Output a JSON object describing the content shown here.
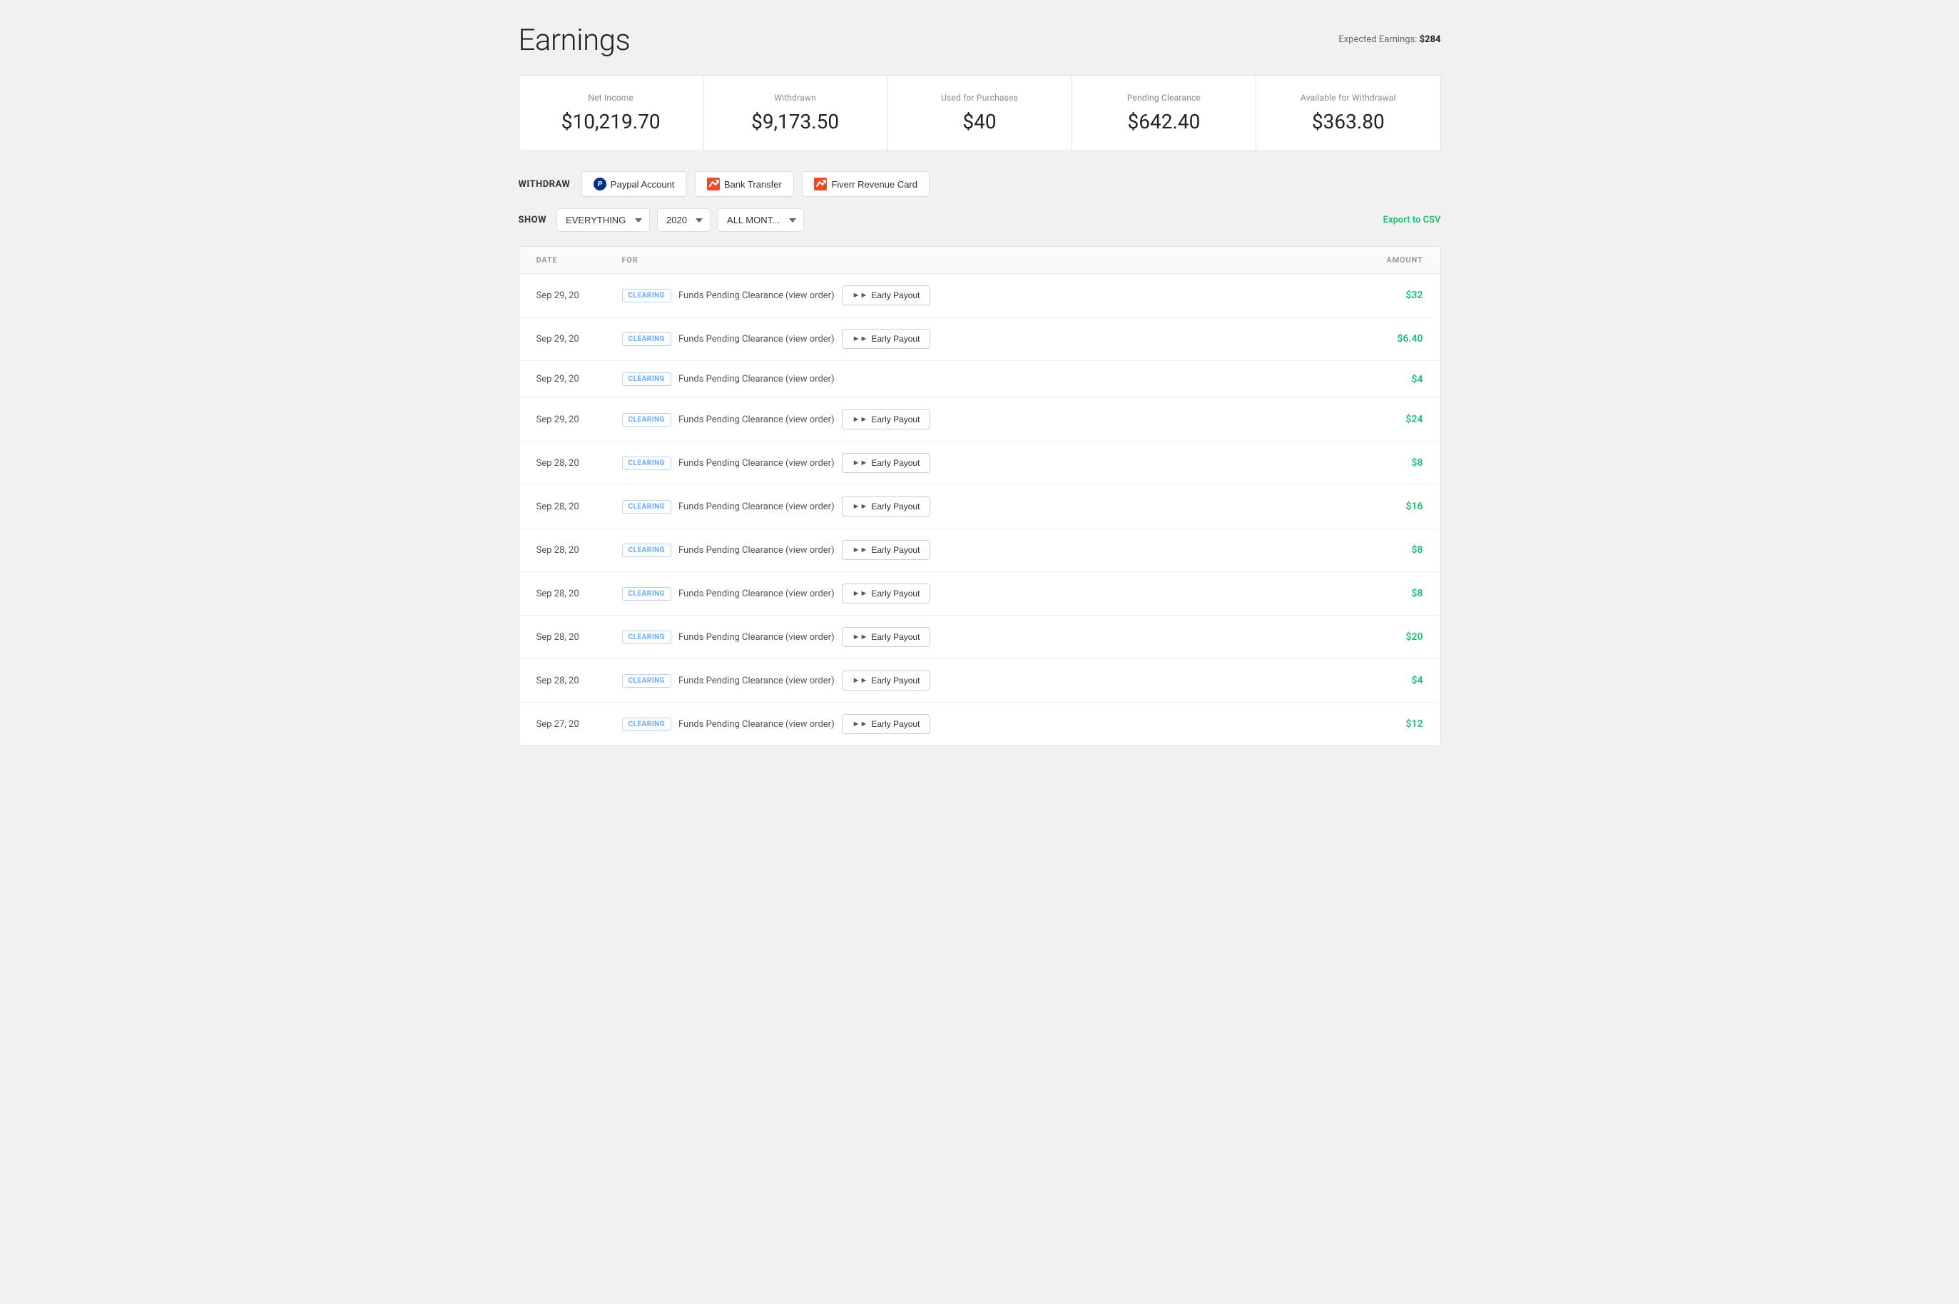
{
  "page": {
    "title": "Earnings",
    "expected_earnings_label": "Expected Earnings:",
    "expected_earnings_value": "$284"
  },
  "summary": {
    "items": [
      {
        "label": "Net Income",
        "value": "$10,219.70"
      },
      {
        "label": "Withdrawn",
        "value": "$9,173.50"
      },
      {
        "label": "Used for Purchases",
        "value": "$40"
      },
      {
        "label": "Pending Clearance",
        "value": "$642.40"
      },
      {
        "label": "Available for Withdrawal",
        "value": "$363.80"
      }
    ]
  },
  "withdraw": {
    "label": "WITHDRAW",
    "buttons": [
      {
        "id": "paypal",
        "label": "Paypal Account"
      },
      {
        "id": "bank",
        "label": "Bank Transfer"
      },
      {
        "id": "fiverr",
        "label": "Fiverr Revenue Card"
      }
    ]
  },
  "show": {
    "label": "SHOW",
    "filters": [
      {
        "id": "type",
        "value": "EVERYTHING"
      },
      {
        "id": "year",
        "value": "2020"
      },
      {
        "id": "month",
        "value": "ALL MONT..."
      }
    ],
    "export_label": "Export to CSV"
  },
  "table": {
    "headers": {
      "date": "DATE",
      "for": "FOR",
      "amount": "AMOUNT"
    },
    "rows": [
      {
        "date": "Sep 29, 20",
        "badge": "CLEARING",
        "description": "Funds Pending Clearance (view order)",
        "has_early_payout": true,
        "amount": "$32"
      },
      {
        "date": "Sep 29, 20",
        "badge": "CLEARING",
        "description": "Funds Pending Clearance (view order)",
        "has_early_payout": true,
        "amount": "$6.40"
      },
      {
        "date": "Sep 29, 20",
        "badge": "CLEARING",
        "description": "Funds Pending Clearance (view order)",
        "has_early_payout": false,
        "amount": "$4"
      },
      {
        "date": "Sep 29, 20",
        "badge": "CLEARING",
        "description": "Funds Pending Clearance (view order)",
        "has_early_payout": true,
        "amount": "$24"
      },
      {
        "date": "Sep 28, 20",
        "badge": "CLEARING",
        "description": "Funds Pending Clearance (view order)",
        "has_early_payout": true,
        "amount": "$8"
      },
      {
        "date": "Sep 28, 20",
        "badge": "CLEARING",
        "description": "Funds Pending Clearance (view order)",
        "has_early_payout": true,
        "amount": "$16"
      },
      {
        "date": "Sep 28, 20",
        "badge": "CLEARING",
        "description": "Funds Pending Clearance (view order)",
        "has_early_payout": true,
        "amount": "$8"
      },
      {
        "date": "Sep 28, 20",
        "badge": "CLEARING",
        "description": "Funds Pending Clearance (view order)",
        "has_early_payout": true,
        "amount": "$8"
      },
      {
        "date": "Sep 28, 20",
        "badge": "CLEARING",
        "description": "Funds Pending Clearance (view order)",
        "has_early_payout": true,
        "amount": "$20"
      },
      {
        "date": "Sep 28, 20",
        "badge": "CLEARING",
        "description": "Funds Pending Clearance (view order)",
        "has_early_payout": true,
        "amount": "$4"
      },
      {
        "date": "Sep 27, 20",
        "badge": "CLEARING",
        "description": "Funds Pending Clearance (view order)",
        "has_early_payout": true,
        "amount": "$12"
      }
    ],
    "early_payout_label": "Early Payout"
  }
}
